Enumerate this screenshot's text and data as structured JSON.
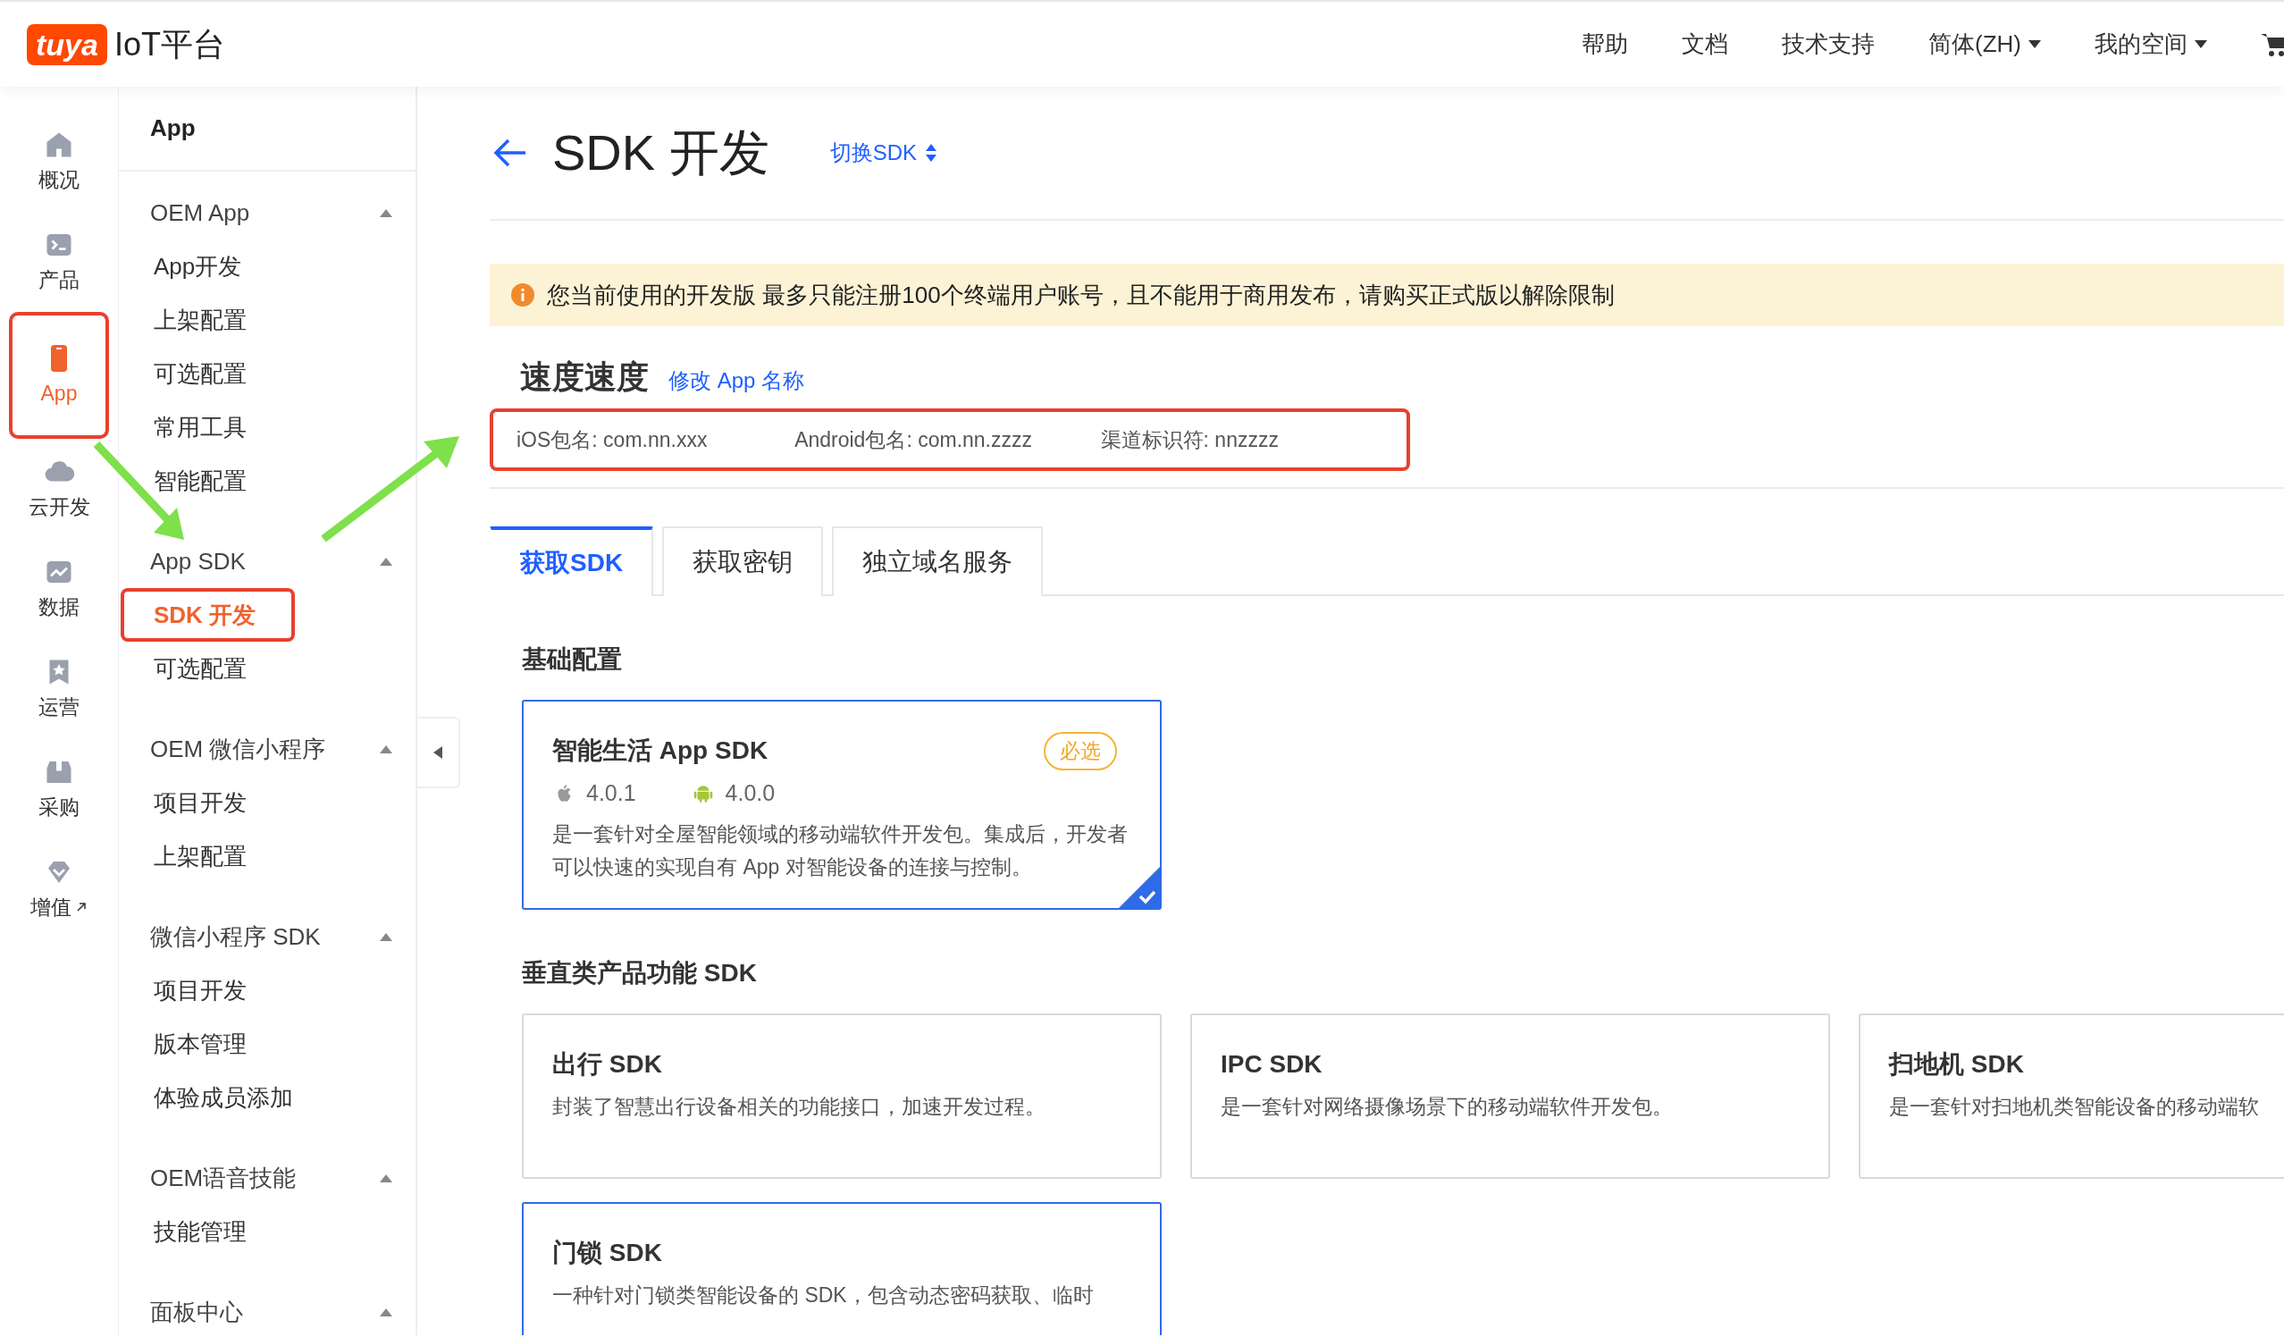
{
  "header": {
    "logo": "tuya",
    "title": "IoT平台",
    "nav": [
      {
        "label": "帮助",
        "dropdown": false
      },
      {
        "label": "文档",
        "dropdown": false
      },
      {
        "label": "技术支持",
        "dropdown": false
      },
      {
        "label": "简体(ZH)",
        "dropdown": true
      },
      {
        "label": "我的空间",
        "dropdown": true
      }
    ]
  },
  "rail": [
    {
      "label": "概况",
      "selected": false,
      "highlighted": false,
      "external": false
    },
    {
      "label": "产品",
      "selected": false,
      "highlighted": false,
      "external": false
    },
    {
      "label": "App",
      "selected": true,
      "highlighted": true,
      "external": false
    },
    {
      "label": "云开发",
      "selected": false,
      "highlighted": false,
      "external": false
    },
    {
      "label": "数据",
      "selected": false,
      "highlighted": false,
      "external": false
    },
    {
      "label": "运营",
      "selected": false,
      "highlighted": false,
      "external": false
    },
    {
      "label": "采购",
      "selected": false,
      "highlighted": false,
      "external": false
    },
    {
      "label": "增值",
      "selected": false,
      "highlighted": false,
      "external": true
    }
  ],
  "menu": {
    "title": "App",
    "groups": [
      {
        "title": "OEM App",
        "expanded": true,
        "items": [
          {
            "label": "App开发",
            "selected": false,
            "highlighted": false
          },
          {
            "label": "上架配置",
            "selected": false,
            "highlighted": false
          },
          {
            "label": "可选配置",
            "selected": false,
            "highlighted": false
          },
          {
            "label": "常用工具",
            "selected": false,
            "highlighted": false
          },
          {
            "label": "智能配置",
            "selected": false,
            "highlighted": false
          }
        ]
      },
      {
        "title": "App SDK",
        "expanded": true,
        "items": [
          {
            "label": "SDK 开发",
            "selected": true,
            "highlighted": true
          },
          {
            "label": "可选配置",
            "selected": false,
            "highlighted": false
          }
        ]
      },
      {
        "title": "OEM 微信小程序",
        "expanded": true,
        "items": [
          {
            "label": "项目开发",
            "selected": false,
            "highlighted": false
          },
          {
            "label": "上架配置",
            "selected": false,
            "highlighted": false
          }
        ]
      },
      {
        "title": "微信小程序 SDK",
        "expanded": true,
        "items": [
          {
            "label": "项目开发",
            "selected": false,
            "highlighted": false
          },
          {
            "label": "版本管理",
            "selected": false,
            "highlighted": false
          },
          {
            "label": "体验成员添加",
            "selected": false,
            "highlighted": false
          }
        ]
      },
      {
        "title": "OEM语音技能",
        "expanded": true,
        "items": [
          {
            "label": "技能管理",
            "selected": false,
            "highlighted": false
          }
        ]
      },
      {
        "title": "面板中心",
        "expanded": true
      }
    ]
  },
  "page": {
    "title": "SDK 开发",
    "switch": "切换SDK",
    "alert": "您当前使用的开发版 最多只能注册100个终端用户账号，且不能用于商用发布，请购买正式版以解除限制",
    "app_name": "速度速度",
    "rename": "修改 App 名称",
    "info": {
      "highlighted": true,
      "fields": [
        "iOS包名: com.nn.xxx",
        "Android包名: com.nn.zzzz",
        "渠道标识符: nnzzzz"
      ]
    },
    "tabs": [
      {
        "label": "获取SDK",
        "selected": true
      },
      {
        "label": "获取密钥",
        "selected": false
      },
      {
        "label": "独立域名服务",
        "selected": false
      }
    ]
  },
  "sections": [
    {
      "title": "基础配置",
      "cards": [
        {
          "title": "智能生活 App SDK",
          "badge": "必选",
          "versions": [
            {
              "kind": "ios",
              "text": "4.0.1"
            },
            {
              "kind": "android",
              "text": "4.0.0"
            }
          ],
          "description": "是一套针对全屋智能领域的移动端软件开发包。集成后，开发者可以快速的实现自有 App 对智能设备的连接与控制。",
          "selected": true,
          "focused": true
        }
      ]
    },
    {
      "title": "垂直类产品功能 SDK",
      "cards": [
        {
          "title": "出行 SDK",
          "description": "封装了智慧出行设备相关的功能接口，加速开发过程。",
          "selected": false,
          "focused": false
        },
        {
          "title": "IPC SDK",
          "description": "是一套针对网络摄像场景下的移动端软件开发包。",
          "selected": false,
          "focused": false
        },
        {
          "title": "扫地机 SDK",
          "description": "是一套针对扫地机类智能设备的移动端软",
          "selected": false,
          "focused": false
        },
        {
          "title": "门锁 SDK",
          "description": "一种针对门锁类智能设备的 SDK，包含动态密码获取、临时",
          "selected": false,
          "focused": true
        }
      ]
    }
  ]
}
